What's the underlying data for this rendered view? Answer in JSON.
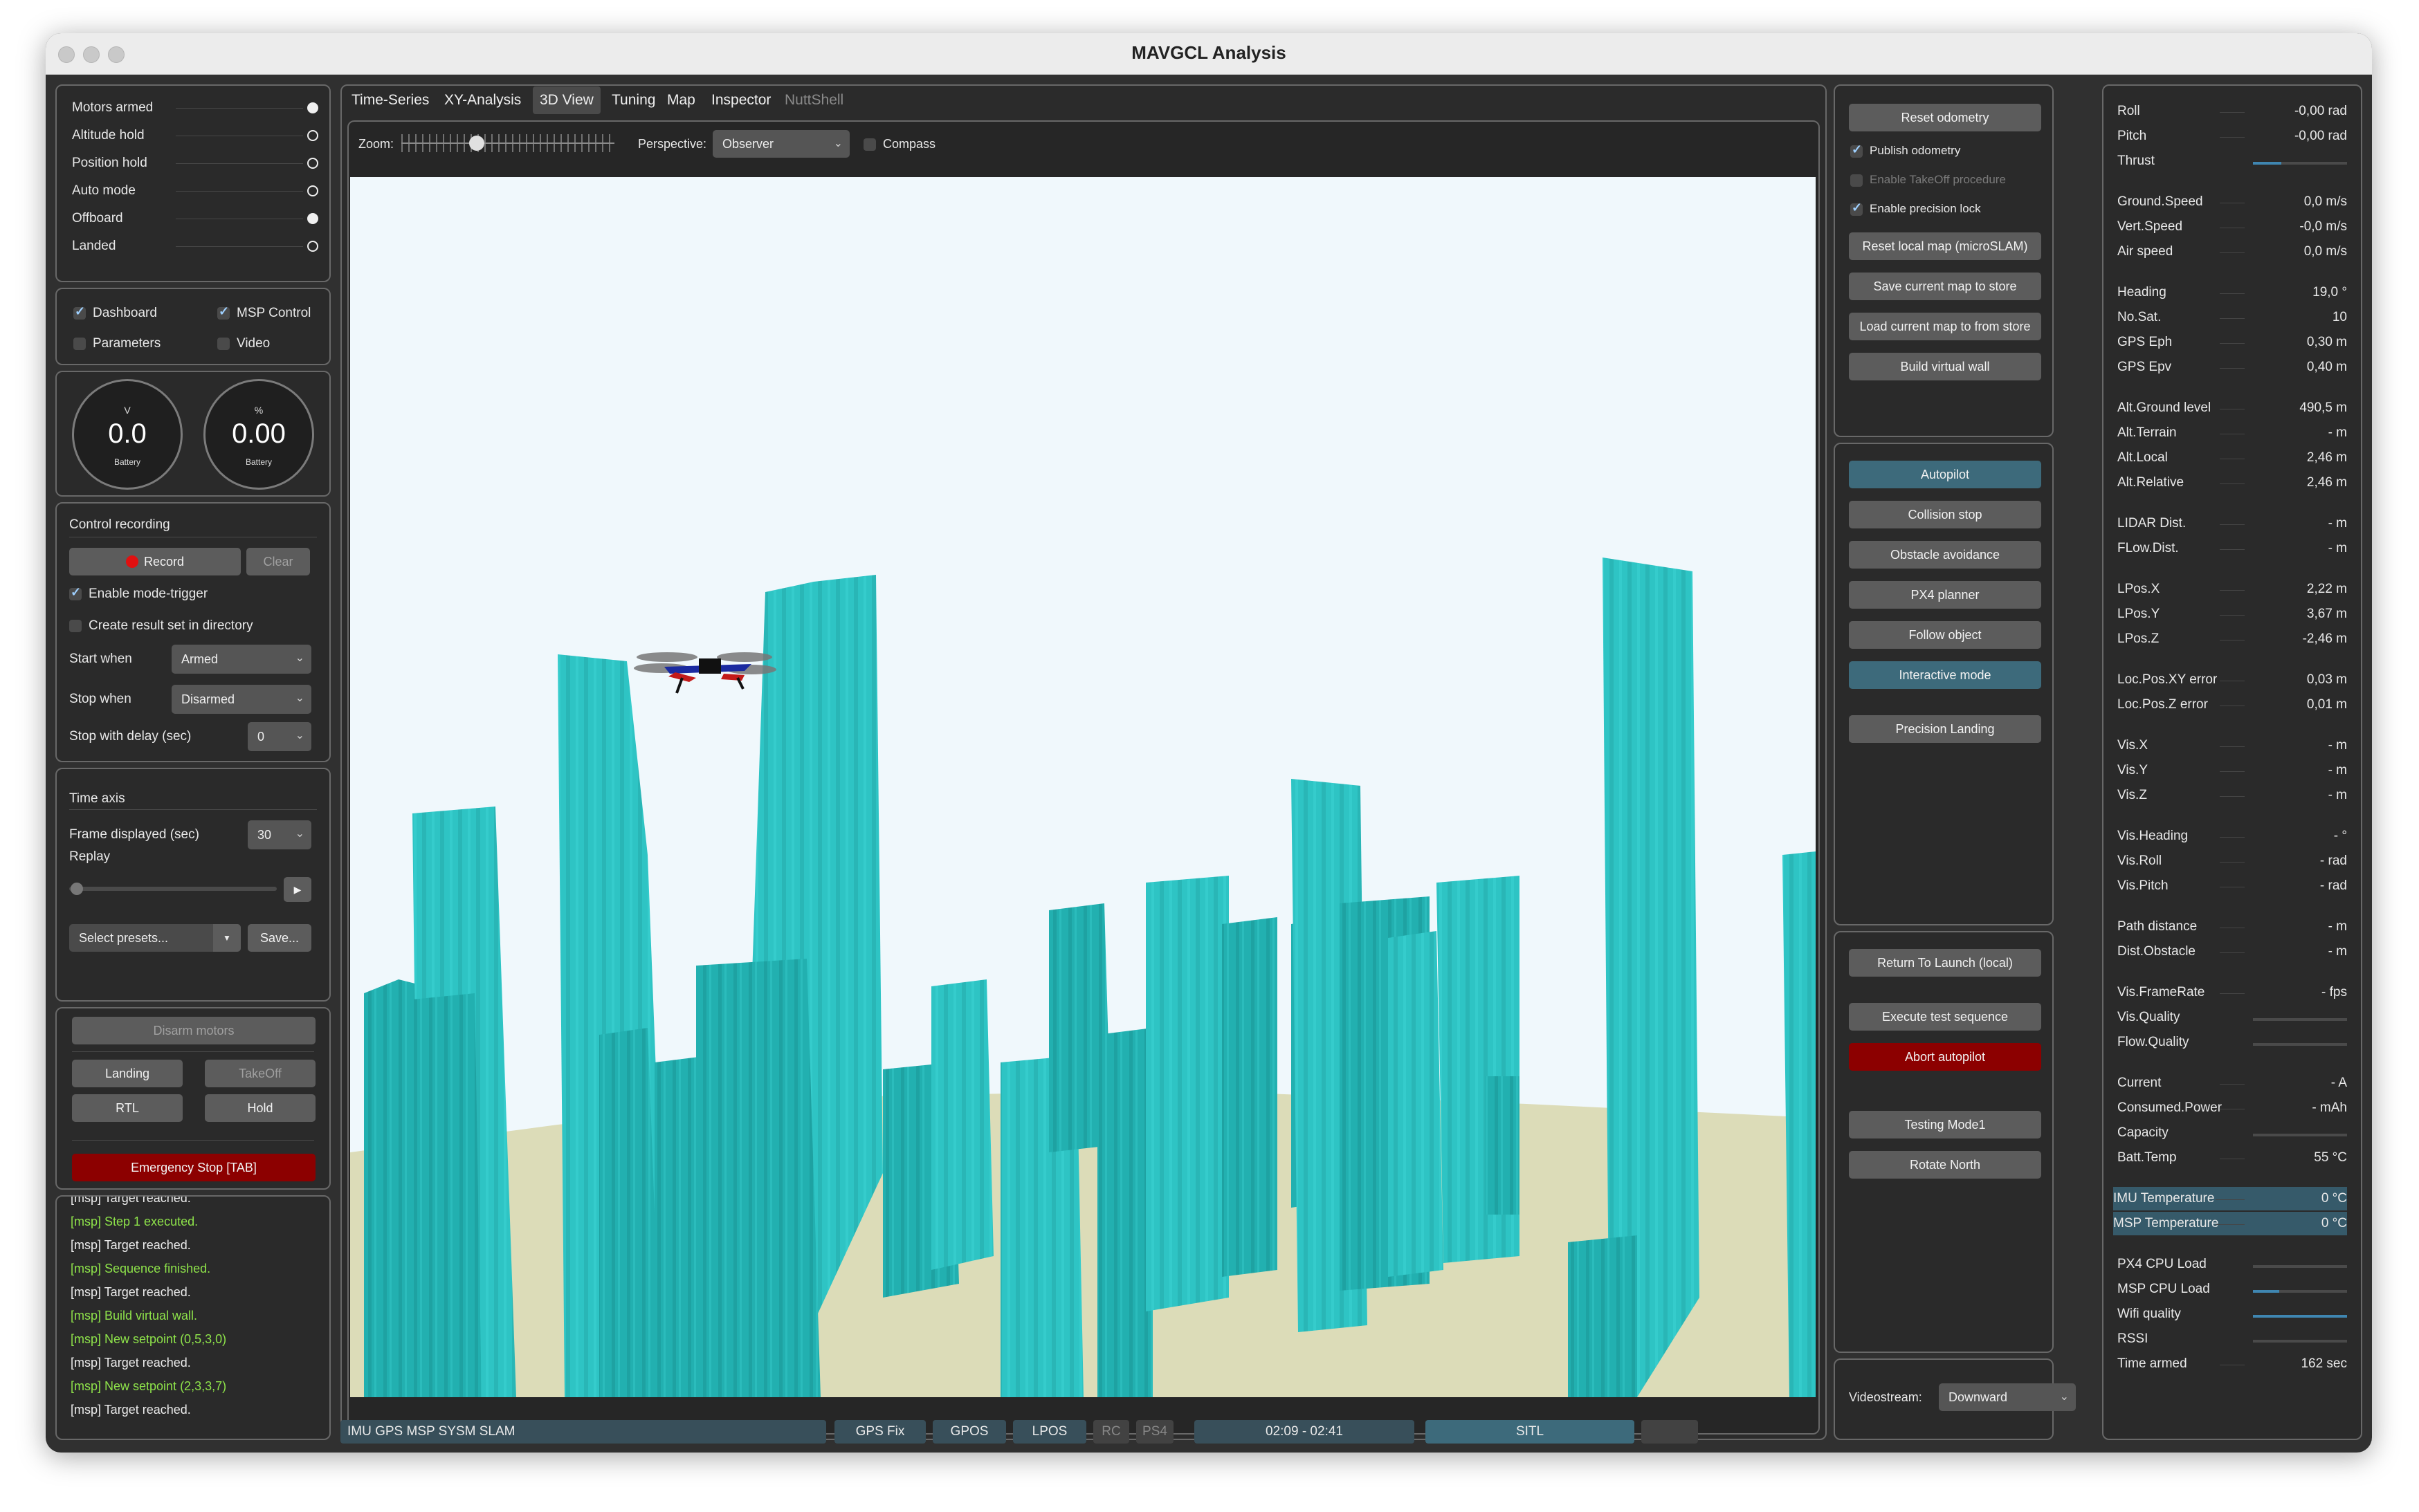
{
  "window": {
    "title": "MAVGCL Analysis"
  },
  "flags": [
    {
      "label": "Motors armed",
      "on": true
    },
    {
      "label": "Altitude hold",
      "on": false
    },
    {
      "label": "Position hold",
      "on": false
    },
    {
      "label": "Auto mode",
      "on": false
    },
    {
      "label": "Offboard",
      "on": true
    },
    {
      "label": "Landed",
      "on": false
    }
  ],
  "views": {
    "dashboard": "Dashboard",
    "msp_control": "MSP Control",
    "parameters": "Parameters",
    "video": "Video"
  },
  "gauges": [
    {
      "unit": "V",
      "value": "0.0",
      "name": "Battery"
    },
    {
      "unit": "%",
      "value": "0.00",
      "name": "Battery"
    }
  ],
  "recording": {
    "title": "Control recording",
    "record": "Record",
    "clear": "Clear",
    "enable_mode_trigger": "Enable mode-trigger",
    "create_result": "Create result set in directory",
    "start_when_label": "Start when",
    "start_when_value": "Armed",
    "stop_when_label": "Stop when",
    "stop_when_value": "Disarmed",
    "stop_delay_label": "Stop with delay (sec)",
    "stop_delay_value": "0"
  },
  "time_axis": {
    "title": "Time axis",
    "frame_label": "Frame displayed (sec)",
    "frame_value": "30",
    "replay": "Replay",
    "presets": "Select presets...",
    "save": "Save..."
  },
  "controls": {
    "disarm": "Disarm motors",
    "landing": "Landing",
    "takeoff": "TakeOff",
    "rtl": "RTL",
    "hold": "Hold",
    "emergency": "Emergency Stop [TAB]"
  },
  "log": [
    {
      "text": "[msp] Target reached.",
      "green": false
    },
    {
      "text": "[msp] Step 1 executed.",
      "green": true
    },
    {
      "text": "[msp] Target reached.",
      "green": false
    },
    {
      "text": "[msp] Sequence finished.",
      "green": true
    },
    {
      "text": "[msp] Target reached.",
      "green": false
    },
    {
      "text": "[msp] Build virtual wall.",
      "green": true
    },
    {
      "text": "[msp] New setpoint (0,5,3,0)",
      "green": true
    },
    {
      "text": "[msp] Target reached.",
      "green": false
    },
    {
      "text": "[msp] New setpoint (2,3,3,7)",
      "green": true
    },
    {
      "text": "[msp] Target reached.",
      "green": false
    }
  ],
  "tabs": [
    "Time-Series",
    "XY-Analysis",
    "3D View",
    "Tuning",
    "Map",
    "Inspector",
    "NuttShell"
  ],
  "toolbar": {
    "zoom": "Zoom:",
    "perspective_label": "Perspective:",
    "perspective_value": "Observer",
    "compass": "Compass"
  },
  "msp": {
    "reset_odometry": "Reset odometry",
    "publish_odometry": "Publish odometry",
    "enable_takeoff": "Enable TakeOff procedure",
    "enable_precision": "Enable precision lock",
    "reset_local_map": "Reset local map (microSLAM)",
    "save_map": "Save current map to store",
    "load_map": "Load current map to from store",
    "build_wall": "Build virtual wall",
    "autopilot": "Autopilot",
    "collision_stop": "Collision stop",
    "obstacle_avoidance": "Obstacle avoidance",
    "px4_planner": "PX4 planner",
    "follow_object": "Follow object",
    "interactive_mode": "Interactive mode",
    "precision_landing": "Precision Landing",
    "return_to_launch": "Return To Launch (local)",
    "execute_test": "Execute test sequence",
    "abort_autopilot": "Abort autopilot",
    "testing_mode": "Testing Mode1",
    "rotate_north": "Rotate North",
    "videostream_label": "Videostream:",
    "videostream_value": "Downward"
  },
  "telemetry": [
    {
      "k": "Roll",
      "v": "-0,00 rad"
    },
    {
      "k": "Pitch",
      "v": "-0,00 rad"
    },
    {
      "k": "Thrust",
      "v": "",
      "bar": 0.3
    },
    {
      "k": "Ground.Speed",
      "v": "0,0 m/s"
    },
    {
      "k": "Vert.Speed",
      "v": "-0,0 m/s"
    },
    {
      "k": "Air speed",
      "v": "0,0 m/s"
    },
    {
      "k": "Heading",
      "v": "19,0 °"
    },
    {
      "k": "No.Sat.",
      "v": "10"
    },
    {
      "k": "GPS Eph",
      "v": "0,30 m"
    },
    {
      "k": "GPS Epv",
      "v": "0,40 m"
    },
    {
      "k": "Alt.Ground level",
      "v": "490,5 m"
    },
    {
      "k": "Alt.Terrain",
      "v": "- m"
    },
    {
      "k": "Alt.Local",
      "v": "2,46 m"
    },
    {
      "k": "Alt.Relative",
      "v": "2,46 m"
    },
    {
      "k": "LIDAR Dist.",
      "v": "- m"
    },
    {
      "k": "FLow.Dist.",
      "v": "- m"
    },
    {
      "k": "LPos.X",
      "v": "2,22 m"
    },
    {
      "k": "LPos.Y",
      "v": "3,67 m"
    },
    {
      "k": "LPos.Z",
      "v": "-2,46 m"
    },
    {
      "k": "Loc.Pos.XY error",
      "v": "0,03 m"
    },
    {
      "k": "Loc.Pos.Z error",
      "v": "0,01 m"
    },
    {
      "k": "Vis.X",
      "v": "- m"
    },
    {
      "k": "Vis.Y",
      "v": "- m"
    },
    {
      "k": "Vis.Z",
      "v": "- m"
    },
    {
      "k": "Vis.Heading",
      "v": "- °"
    },
    {
      "k": "Vis.Roll",
      "v": "- rad"
    },
    {
      "k": "Vis.Pitch",
      "v": "- rad"
    },
    {
      "k": "Path distance",
      "v": "- m"
    },
    {
      "k": "Dist.Obstacle",
      "v": "- m"
    },
    {
      "k": "Vis.FrameRate",
      "v": "- fps"
    },
    {
      "k": "Vis.Quality",
      "v": "",
      "bar": 0
    },
    {
      "k": "Flow.Quality",
      "v": "",
      "bar": 0
    },
    {
      "k": "Current",
      "v": "- A"
    },
    {
      "k": "Consumed.Power",
      "v": "- mAh"
    },
    {
      "k": "Capacity",
      "v": "",
      "bar": 0
    },
    {
      "k": "Batt.Temp",
      "v": "55 °C"
    },
    {
      "k": "IMU Temperature",
      "v": "0 °C",
      "hl": true
    },
    {
      "k": "MSP Temperature",
      "v": "0 °C",
      "hl": true
    },
    {
      "k": "PX4 CPU Load",
      "v": "",
      "bar": 0
    },
    {
      "k": "MSP CPU Load",
      "v": "",
      "bar": 0.28
    },
    {
      "k": "Wifi quality",
      "v": "",
      "bar": 1.0
    },
    {
      "k": "RSSI",
      "v": "",
      "bar": 0
    },
    {
      "k": "Time armed",
      "v": "162 sec"
    }
  ],
  "statusbar": {
    "sensors": "IMU GPS MSP SYSM SLAM",
    "gps_fix": "GPS Fix",
    "gpos": "GPOS",
    "lpos": "LPOS",
    "rc": "RC",
    "ps4": "PS4",
    "time": "02:09 - 02:41",
    "mode": "SITL"
  },
  "colors": {
    "window_bg": "#303030",
    "button": "#5c5c5c",
    "accent_blue": "#3d6a7b",
    "danger": "#8c0000",
    "obstacle": "#2ec4c4",
    "sky": "#f0f8fc",
    "ground": "#dcdcb8",
    "log_green": "#8ee34a"
  }
}
